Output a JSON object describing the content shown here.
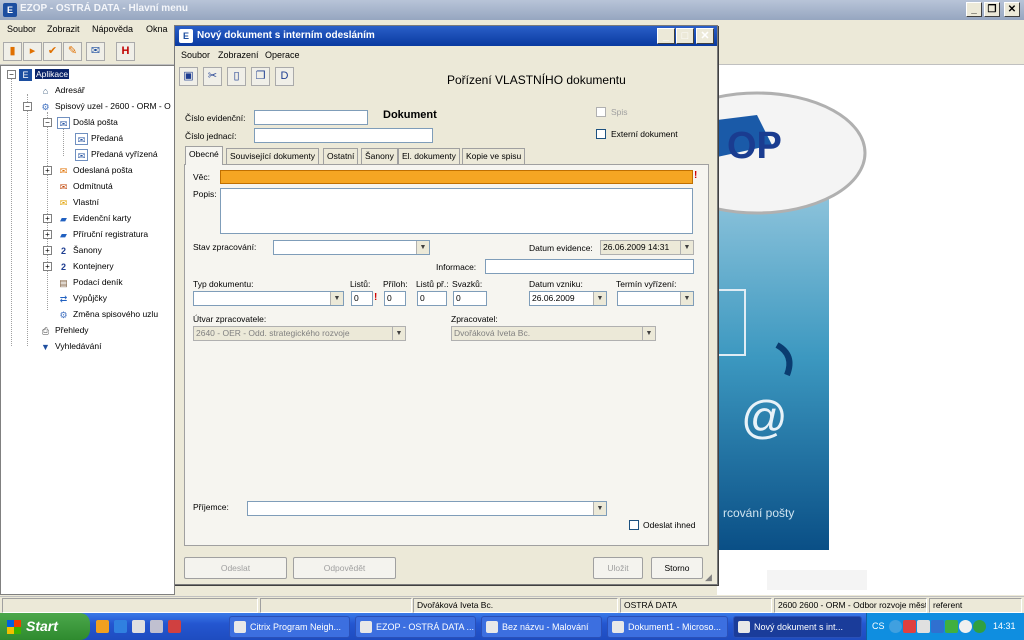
{
  "main_window": {
    "title": "EZOP - OSTRÁ DATA - Hlavní menu",
    "menu": [
      "Soubor",
      "Zobrazit",
      "Nápověda",
      "Okna"
    ]
  },
  "tree": {
    "root": "Aplikace",
    "items": [
      {
        "label": "Adresář",
        "icon": "building-icon"
      },
      {
        "label": "Spisový uzel - 2600 - ORM - O",
        "icon": "network-icon"
      },
      {
        "label": "Došlá pošta",
        "icon": "envelope-icon"
      },
      {
        "label": "Předaná",
        "icon": "envelope-icon"
      },
      {
        "label": "Předaná vyřízená",
        "icon": "envelope-icon"
      },
      {
        "label": "Odeslaná pošta",
        "icon": "envelope-out-icon"
      },
      {
        "label": "Odmítnutá",
        "icon": "envelope-x-icon"
      },
      {
        "label": "Vlastní",
        "icon": "envelope-own-icon"
      },
      {
        "label": "Evidenční karty",
        "icon": "folder-icon"
      },
      {
        "label": "Příruční registratura",
        "icon": "folder-icon"
      },
      {
        "label": "Šanony",
        "icon": "binder-icon"
      },
      {
        "label": "Kontejnery",
        "icon": "container-icon"
      },
      {
        "label": "Podací deník",
        "icon": "journal-icon"
      },
      {
        "label": "Výpůjčky",
        "icon": "loan-icon"
      },
      {
        "label": "Změna spisového uzlu",
        "icon": "network-icon"
      },
      {
        "label": "Přehledy",
        "icon": "printer-icon"
      },
      {
        "label": "Vyhledávání",
        "icon": "filter-icon"
      }
    ]
  },
  "dialog": {
    "title": "Nový dokument s interním odesláním",
    "menu": [
      "Soubor",
      "Zobrazení",
      "Operace"
    ],
    "heading": "Pořízení VLASTNÍHO dokumentu",
    "section_label": "Dokument",
    "cislo_evidencni_label": "Číslo evidenční:",
    "cislo_jednaci_label": "Číslo jednací:",
    "spis_label": "Spis",
    "externi_label": "Externí dokument",
    "tabs": [
      "Obecné",
      "Související dokumenty",
      "Ostatní",
      "Šanony",
      "El. dokumenty",
      "Kopie ve spisu"
    ],
    "vec_label": "Věc:",
    "popis_label": "Popis:",
    "stav_label": "Stav zpracování:",
    "datum_evidence_label": "Datum evidence:",
    "datum_evidence_value": "26.06.2009 14:31",
    "informace_label": "Informace:",
    "typ_label": "Typ dokumentu:",
    "listu_label": "Listů:",
    "listu_value": "0",
    "priloh_label": "Příloh:",
    "priloh_value": "0",
    "listu_pr_label": "Listů př.:",
    "listu_pr_value": "0",
    "svazku_label": "Svazků:",
    "svazku_value": "0",
    "datum_vzniku_label": "Datum vzniku:",
    "datum_vzniku_value": "26.06.2009",
    "termin_label": "Termín vyřízení:",
    "utvar_label": "Útvar zpracovatele:",
    "utvar_value": "2640 - OER - Odd. strategického rozvoje",
    "zpracovatel_label": "Zpracovatel:",
    "zpracovatel_value": "Dvořáková Iveta  Bc.",
    "prijemce_label": "Příjemce:",
    "odeslat_ihned_label": "Odeslat ihned",
    "buttons": {
      "odeslat": "Odeslat",
      "odpovedet": "Odpovědět",
      "ulozit": "Uložit",
      "storno": "Storno"
    }
  },
  "background": {
    "caption": "rcování pošty",
    "logo_text": "OP",
    "at_sign": "@"
  },
  "status": [
    "Dvořáková Iveta  Bc.",
    "OSTRÁ DATA",
    "2600 2600 - ORM - Odbor rozvoje městi",
    "referent"
  ],
  "taskbar": {
    "start": "Start",
    "tasks": [
      "Citrix Program Neigh...",
      "EZOP - OSTRÁ DATA ...",
      "Bez názvu - Malování",
      "Dokument1 - Microso...",
      "Nový dokument s int..."
    ],
    "lang": "CS",
    "clock": "14:31"
  },
  "colors": {
    "required_field": "#f5a623",
    "title_active": "#0a3aa0"
  }
}
